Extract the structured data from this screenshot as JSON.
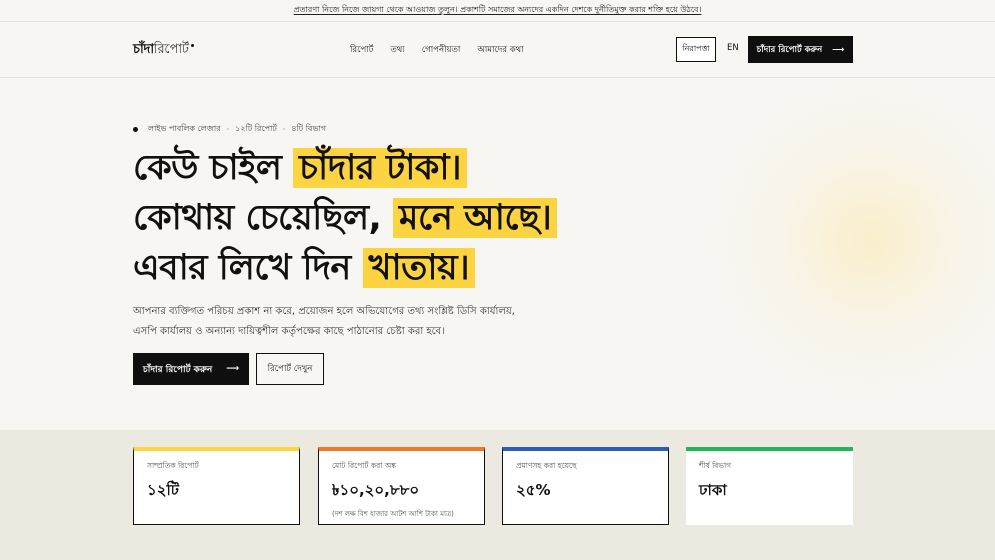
{
  "announcement": "প্রতারণা নিজে নিজে জায়গা থেকে আওয়াজ তুলুন। প্রকাশটি সমাজের অন্যদের একদিন দেশকে দুর্নীতিমুক্ত করার শক্তি হয়ে উঠবে।",
  "nav": {
    "logo_bold": "চাঁদা",
    "logo_light": "রিপোর্ট",
    "menu": [
      "রিপোর্ট",
      "তথ্য",
      "গোপনীয়তা",
      "আমাদের কথা"
    ],
    "status_button": "নিরাপত্তা",
    "language": "EN",
    "cta_label": "চাঁদার রিপোর্ট করুন",
    "cta_arrow": "⟶"
  },
  "hero": {
    "meta": [
      "লাইভ পাবলিক লেজার",
      "·",
      "১২টি রিপোর্ট",
      "·",
      "৪টি বিভাগ"
    ],
    "line1_plain": "কেউ চাইল",
    "line1_highlight": "চাঁদার টাকা।",
    "line2_plain": "কোথায় চেয়েছিল,",
    "line2_highlight": "মনে আছে।",
    "line3_plain": "এবার লিখে দিন",
    "line3_highlight": "খাতায়।",
    "description": "আপনার ব্যক্তিগত পরিচয় প্রকাশ না করে, প্রয়োজন হলে অভিযোগের তথ্য সংশ্লিষ্ট ডিসি কার্যালয়, এসপি কার্যালয় ও অন্যান্য দায়িত্বশীল কর্তৃপক্ষের কাছে পাঠানোর চেষ্টা করা হবে।",
    "primary_button": "চাঁদার রিপোর্ট করুন",
    "primary_arrow": "⟶",
    "secondary_button": "রিপোর্ট দেখুন"
  },
  "stats": [
    {
      "label": "সাম্প্রতিক রিপোর্ট",
      "value": "১২টি",
      "sub": ""
    },
    {
      "label": "মোট রিপোর্ট করা অঙ্ক",
      "value": "৳১০,২০,৮৮০",
      "sub": "(দশ লক্ষ বিশ হাজার আটশ আশি টাকা মাত্র)"
    },
    {
      "label": "প্রমাণসহ করা হয়েছে",
      "value": "২৫%",
      "sub": ""
    },
    {
      "label": "শীর্ষ বিভাগ",
      "value": "ঢাকা",
      "sub": ""
    }
  ],
  "colors": {
    "highlight": "#fcd441",
    "card1_accent": "#fcd441",
    "card2_accent": "#f07a27",
    "card3_accent": "#2f5dba",
    "card4_accent": "#27b25d",
    "button_dark": "#0f0f0f"
  }
}
